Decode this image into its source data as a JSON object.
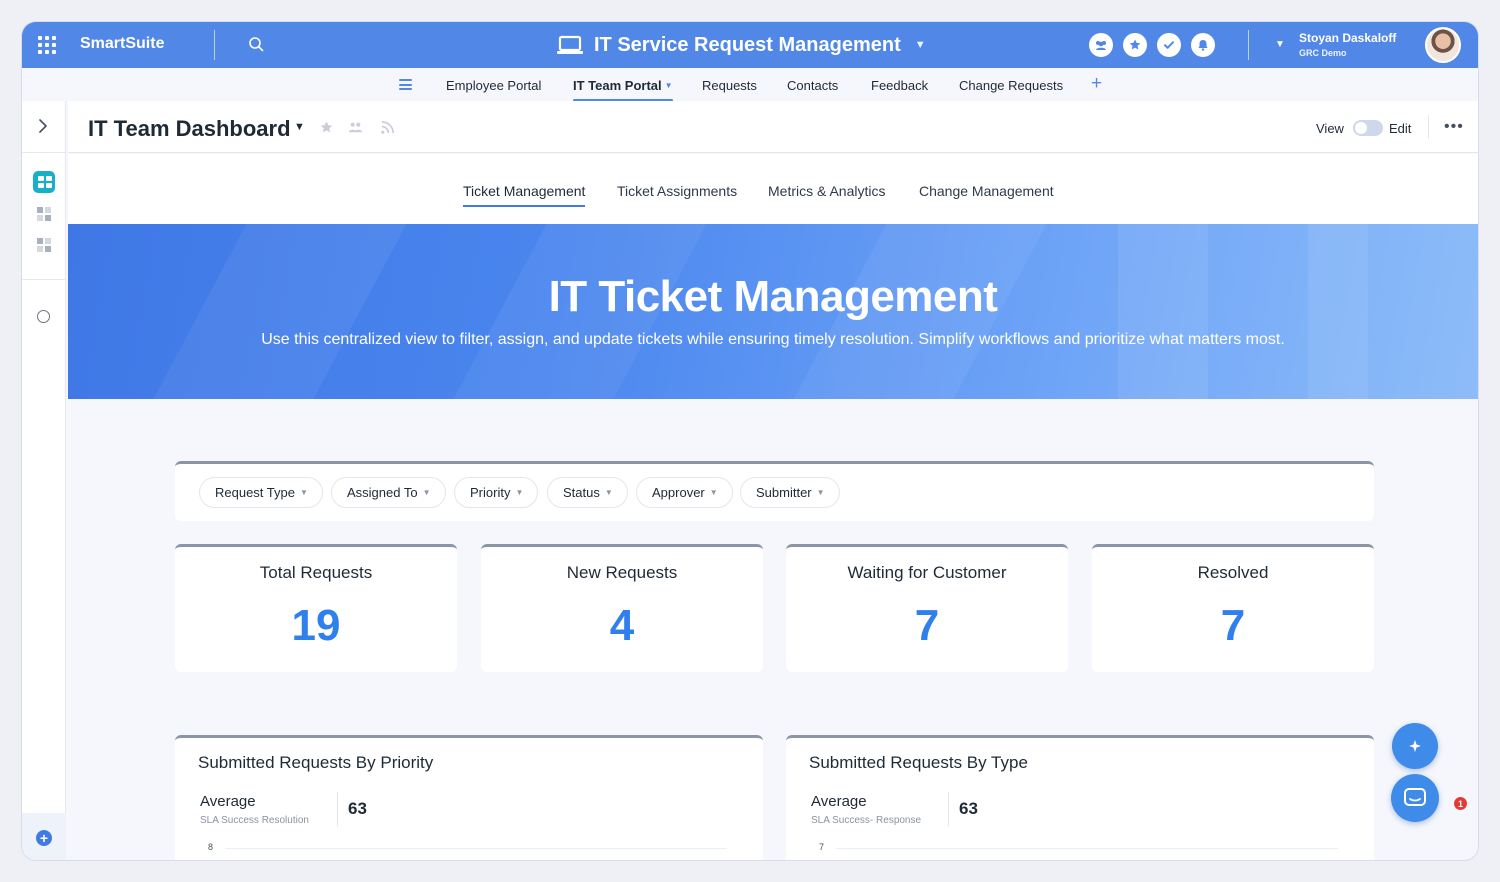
{
  "topbar": {
    "brand": "SmartSuite",
    "app_title": "IT Service Request Management",
    "user_name": "Stoyan Daskaloff",
    "user_org": "GRC Demo"
  },
  "nav": {
    "items": [
      "Employee Portal",
      "IT Team Portal",
      "Requests",
      "Contacts",
      "Feedback",
      "Change Requests"
    ],
    "active": "IT Team Portal"
  },
  "header": {
    "title": "IT Team Dashboard",
    "view_label": "View",
    "edit_label": "Edit"
  },
  "subtabs": [
    "Ticket Management",
    "Ticket Assignments",
    "Metrics & Analytics",
    "Change Management"
  ],
  "banner": {
    "title": "IT Ticket Management",
    "subtitle": "Use this centralized view to filter, assign, and update tickets while ensuring timely resolution. Simplify workflows and prioritize what matters most."
  },
  "filters": [
    "Request Type",
    "Assigned To",
    "Priority",
    "Status",
    "Approver",
    "Submitter"
  ],
  "stats": [
    {
      "title": "Total Requests",
      "value": "19"
    },
    {
      "title": "New Requests",
      "value": "4"
    },
    {
      "title": "Waiting for Customer",
      "value": "7"
    },
    {
      "title": "Resolved",
      "value": "7"
    }
  ],
  "charts": [
    {
      "title": "Submitted Requests By Priority",
      "avg_label": "Average",
      "avg_sub": "SLA Success Resolution",
      "avg_value": "63",
      "y_tick": "8"
    },
    {
      "title": "Submitted Requests By Type",
      "avg_label": "Average",
      "avg_sub": "SLA Success- Response",
      "avg_value": "63",
      "y_tick": "7"
    }
  ],
  "chat_badge": "1",
  "colors": {
    "primary": "#5187e6",
    "accent_value": "#2f80ed",
    "dashboard_icon": "#17b0c7"
  }
}
